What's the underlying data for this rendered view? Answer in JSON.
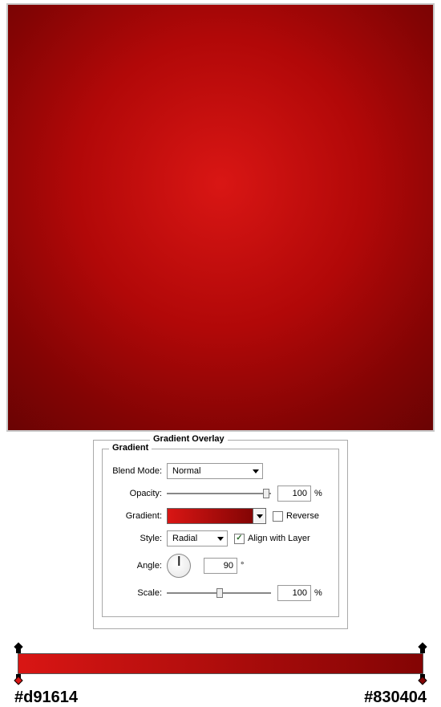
{
  "panel": {
    "title": "Gradient Overlay",
    "sectionTitle": "Gradient",
    "labels": {
      "blendMode": "Blend Mode:",
      "opacity": "Opacity:",
      "gradient": "Gradient:",
      "style": "Style:",
      "angle": "Angle:",
      "scale": "Scale:"
    },
    "blendModeValue": "Normal",
    "opacityValue": "100",
    "percentUnit": "%",
    "degreeUnit": "°",
    "reverseLabel": "Reverse",
    "reverseChecked": false,
    "styleValue": "Radial",
    "alignLabel": "Align with Layer",
    "alignChecked": true,
    "angleValue": "90",
    "scaleValue": "100"
  },
  "gradient": {
    "startHex": "#d91614",
    "endHex": "#830404"
  }
}
